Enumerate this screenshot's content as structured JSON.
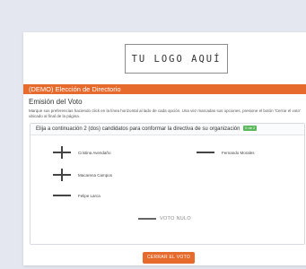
{
  "logo": {
    "text": "TU LOGO AQUÍ"
  },
  "banner": {
    "title": "(DEMO) Elección de Directorio"
  },
  "section": {
    "title": "Emisión del Voto",
    "instructions": "Marque sus preferencias haciendo click en la línea horizontal al lado de cada opción. Una vez marcadas sus opciones, presione el botón 'Cerrar el voto' ubicado al final de la página."
  },
  "ballot": {
    "prompt": "Elija a continuación 2 (dos) candidatos para conformar la directiva de su organización",
    "badge": "0 de 2",
    "options": [
      {
        "label": "Cristina Avendaño",
        "marked": true
      },
      {
        "label": "Fernando Morales",
        "marked": false
      },
      {
        "label": "Macarena Campos",
        "marked": true
      },
      {
        "label": "Felipe Larca",
        "marked": false
      }
    ],
    "null_vote": "VOTO NULO"
  },
  "actions": {
    "cast_vote_label": "CERRAR EL VOTO"
  },
  "colors": {
    "accent": "#e66a2c",
    "badge": "#5cb85c"
  }
}
